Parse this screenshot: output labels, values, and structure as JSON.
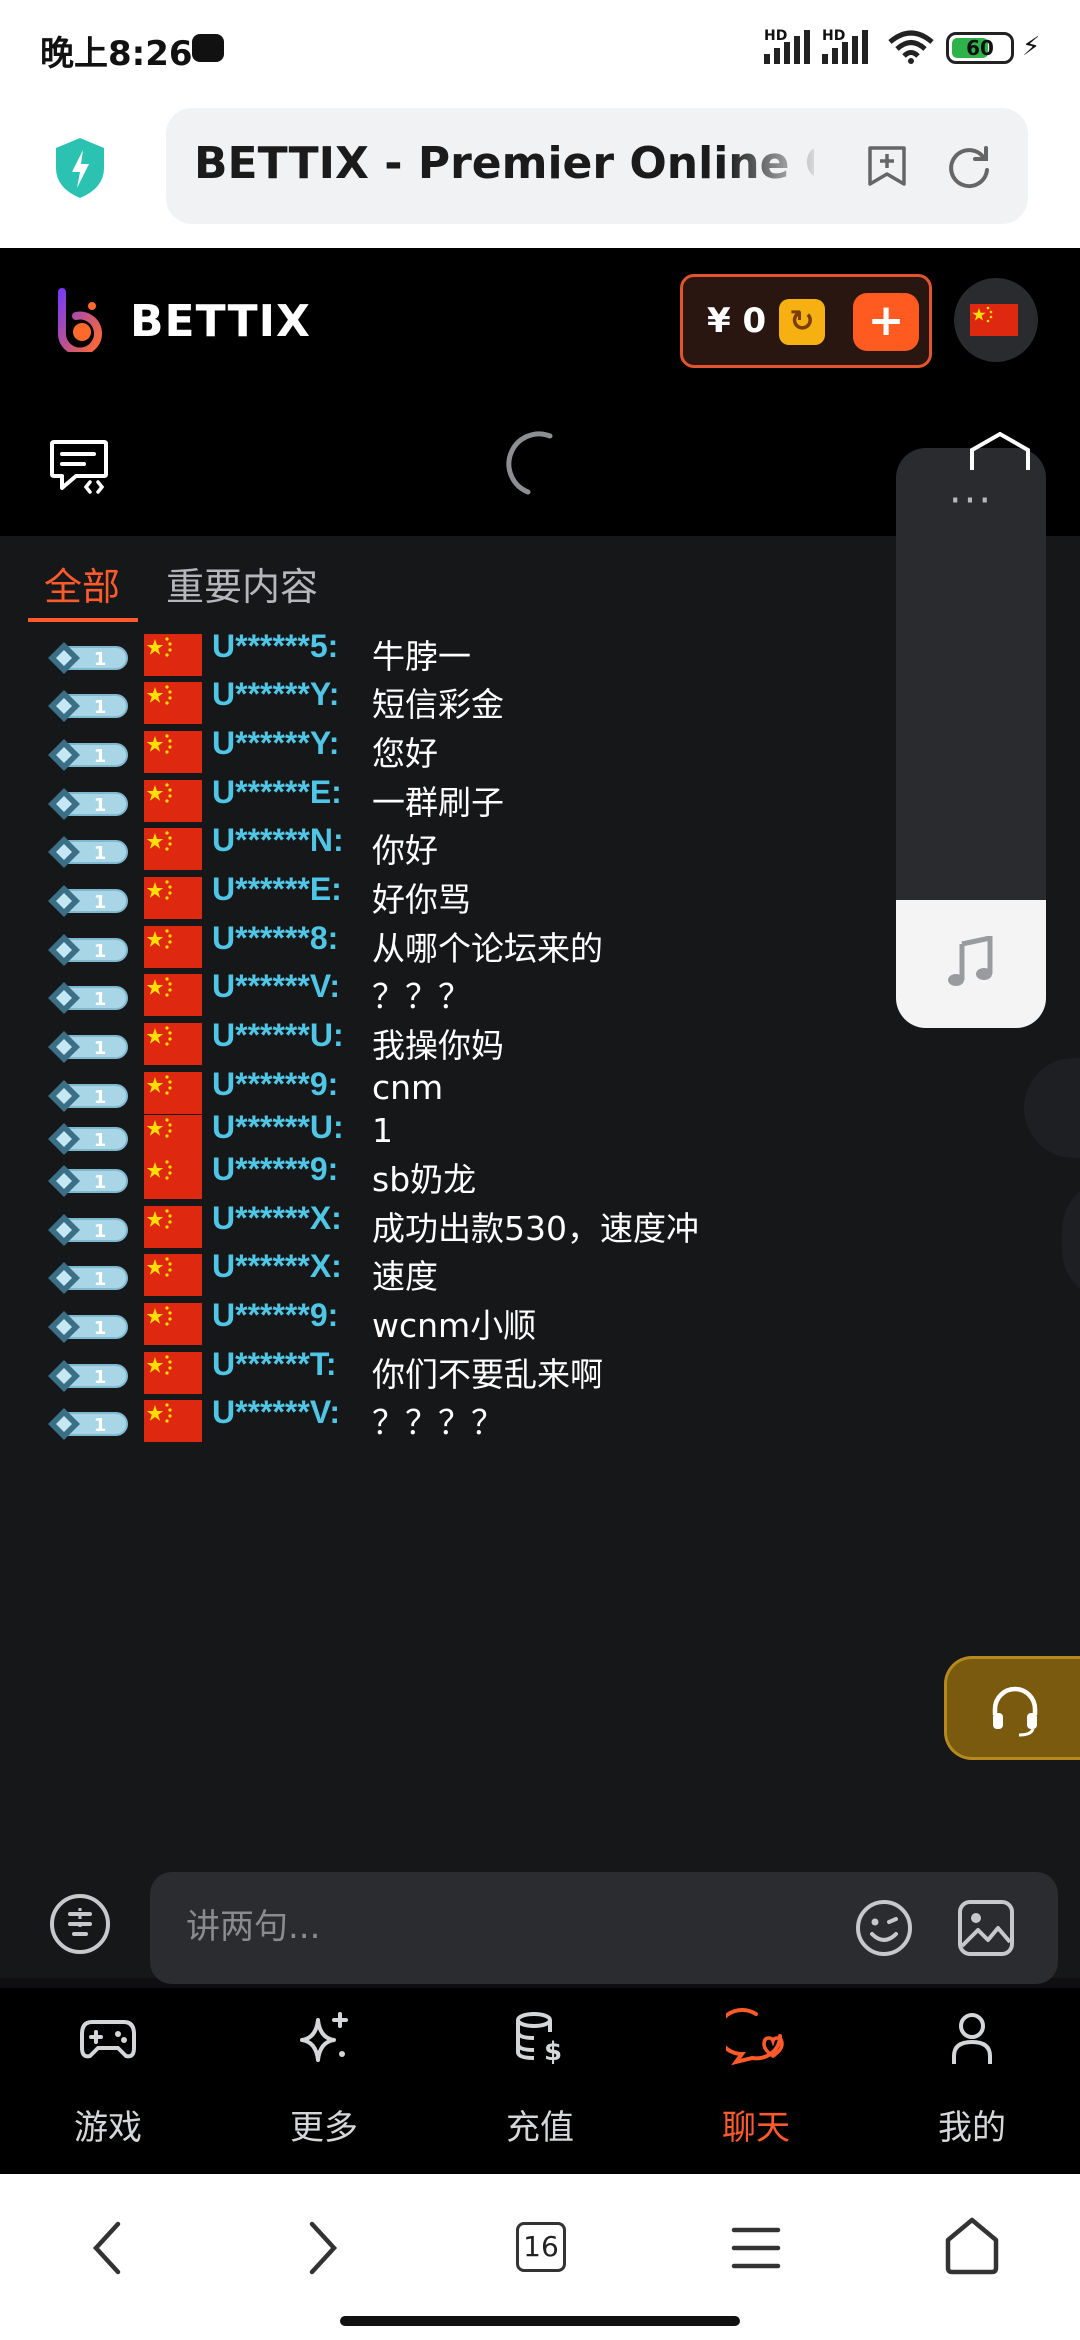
{
  "status_bar": {
    "time": "晚上8:26",
    "battery": "60",
    "signal_label": "HD"
  },
  "browser": {
    "page_title": "BETTIX - Premier Online Game"
  },
  "header": {
    "brand": "BETTIX",
    "balance": "¥ 0"
  },
  "chat": {
    "tabs": [
      {
        "label": "全部"
      },
      {
        "label": "重要内容"
      }
    ],
    "level_badge": "1",
    "messages": [
      {
        "user": "U******5:",
        "text": "牛脖一"
      },
      {
        "user": "U******Y:",
        "text": "短信彩金"
      },
      {
        "user": "U******Y:",
        "text": "您好"
      },
      {
        "user": "U******E:",
        "text": "一群刷子"
      },
      {
        "user": "U******N:",
        "text": "你好"
      },
      {
        "user": "U******E:",
        "text": "好你骂"
      },
      {
        "user": "U******8:",
        "text": "从哪个论坛来的"
      },
      {
        "user": "U******V:",
        "text": "？？？"
      },
      {
        "user": "U******U:",
        "text": "我操你妈"
      },
      {
        "user": "U******9:",
        "text": "cnm"
      },
      {
        "user": "U******U:",
        "text": "1"
      },
      {
        "user": "U******9:",
        "text": "sb奶龙"
      },
      {
        "user": "U******X:",
        "text": "成功出款530，速度冲"
      },
      {
        "user": "U******X:",
        "text": "速度"
      },
      {
        "user": "U******9:",
        "text": "wcnm小顺"
      },
      {
        "user": "U******T:",
        "text": "你们不要乱来啊"
      },
      {
        "user": "U******V:",
        "text": "？？？？"
      }
    ],
    "input_placeholder": "讲两句..."
  },
  "floating_panel": {
    "more_label": "···"
  },
  "bottom_nav": [
    {
      "label": "游戏",
      "icon": "gamepad-icon"
    },
    {
      "label": "更多",
      "icon": "sparkle-icon"
    },
    {
      "label": "充值",
      "icon": "coins-icon"
    },
    {
      "label": "聊天",
      "icon": "chat-icon",
      "active": true
    },
    {
      "label": "我的",
      "icon": "user-icon"
    }
  ],
  "system_nav": {
    "tab_count": "16"
  },
  "colors": {
    "accent": "#ff5a2c",
    "username": "#4fc6e6",
    "background": "#161719"
  }
}
